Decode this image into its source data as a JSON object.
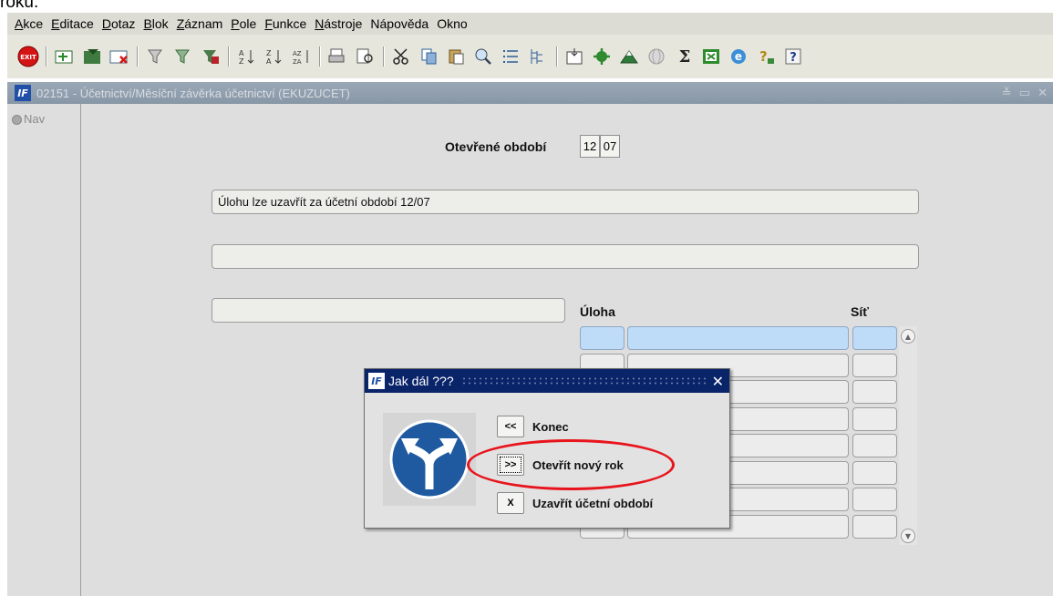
{
  "top_text": "roku.",
  "menu": [
    {
      "key": "A",
      "rest": "kce"
    },
    {
      "key": "E",
      "rest": "ditace"
    },
    {
      "key": "D",
      "rest": "otaz"
    },
    {
      "key": "B",
      "rest": "lok"
    },
    {
      "key": "Z",
      "rest": "áznam"
    },
    {
      "key": "P",
      "rest": "ole"
    },
    {
      "key": "F",
      "rest": "unkce"
    },
    {
      "key": "N",
      "rest": "ástroje"
    },
    {
      "key": "",
      "rest": "Nápověda"
    },
    {
      "key": "",
      "rest": "Okno"
    }
  ],
  "menu_labels": [
    "Akce",
    "Editace",
    "Dotaz",
    "Blok",
    "Záznam",
    "Pole",
    "Funkce",
    "Nástroje",
    "Nápověda",
    "Okno"
  ],
  "toolbar": {
    "exit_label": "EXIT",
    "icons": [
      "exit-icon",
      "new-record-icon",
      "save-record-icon",
      "delete-record-icon",
      "query-icon",
      "query-run-icon",
      "query-cancel-icon",
      "sort-asc-icon",
      "sort-desc-icon",
      "sort-multi-icon",
      "print-icon",
      "print-preview-icon",
      "cut-icon",
      "copy-icon",
      "paste-icon",
      "search-icon",
      "list-icon",
      "tree-icon",
      "export-icon",
      "settings-icon",
      "mountain-icon",
      "globe-icon",
      "sum-icon",
      "excel-icon",
      "browser-icon",
      "help-topic-icon",
      "help-icon"
    ]
  },
  "window": {
    "title": "02151 - Účetnictví/Měsíční závěrka účetnictví (EKUZUCET)",
    "controls": "≚ ▭ ✕"
  },
  "nav": {
    "label": "Nav"
  },
  "form": {
    "period_label": "Otevřené období",
    "period_month": "12",
    "period_year": "07",
    "message1": "Úlohu lze uzavřít za účetní období 12/07",
    "message2": "",
    "message3": "",
    "col_task": "Úloha",
    "col_net": "Síť"
  },
  "dialog": {
    "title": "Jak dál ???",
    "close": "✕",
    "buttons": [
      {
        "symbol": "<<",
        "label": "Konec"
      },
      {
        "symbol": ">>",
        "label": "Otevřít nový rok"
      },
      {
        "symbol": "X",
        "label": "Uzavřít účetní období"
      }
    ]
  },
  "colors": {
    "active_row": "#bedcf8",
    "dialog_title": "#0a246a",
    "highlight": "#e8141c",
    "sign_blue": "#1f5aa0"
  }
}
